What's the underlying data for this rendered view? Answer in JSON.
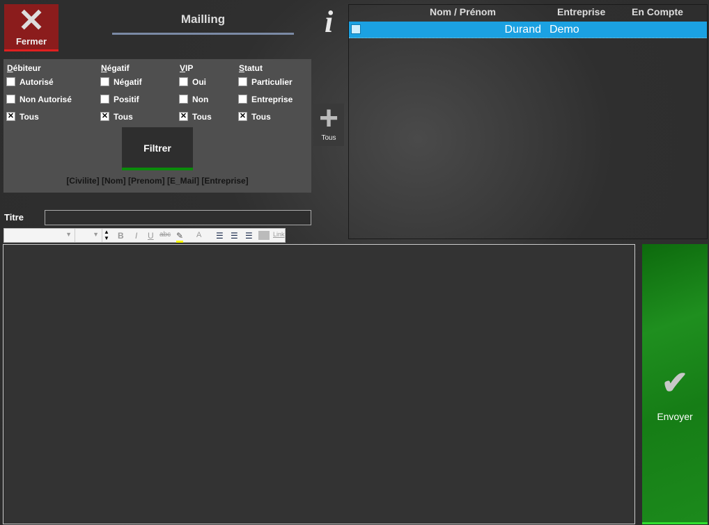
{
  "header": {
    "close_label": "Fermer",
    "title": "Mailling"
  },
  "filters": {
    "columns": [
      {
        "title_first": "D",
        "title_rest": "ébiteur",
        "options": [
          {
            "label": "Autorisé",
            "checked": false
          },
          {
            "label": "Non Autorisé",
            "checked": false
          },
          {
            "label": "Tous",
            "checked": true
          }
        ]
      },
      {
        "title_first": "N",
        "title_rest": "égatif",
        "options": [
          {
            "label": "Négatif",
            "checked": false
          },
          {
            "label": "Positif",
            "checked": false
          },
          {
            "label": "Tous",
            "checked": true
          }
        ]
      },
      {
        "title_first": "V",
        "title_rest": "IP",
        "options": [
          {
            "label": "Oui",
            "checked": false
          },
          {
            "label": "Non",
            "checked": false
          },
          {
            "label": "Tous",
            "checked": true
          }
        ]
      },
      {
        "title_first": "S",
        "title_rest": "tatut",
        "options": [
          {
            "label": "Particulier",
            "checked": false
          },
          {
            "label": "Entreprise",
            "checked": false
          },
          {
            "label": "Tous",
            "checked": true
          }
        ]
      }
    ],
    "filter_button": "Filtrer",
    "fields": "[Civilite] [Nom] [Prenom] [E_Mail] [Entreprise]"
  },
  "add_all": {
    "label": "Tous"
  },
  "grid": {
    "columns": [
      "Nom / Prénom",
      "Entreprise",
      "En Compte"
    ],
    "rows": [
      {
        "nom": "Durand",
        "entreprise": "Demo",
        "en_compte": "",
        "selected": true,
        "checked": false
      }
    ],
    "selected_color": "#1ba1e2"
  },
  "titre": {
    "label": "Titre",
    "value": ""
  },
  "toolbar": {
    "bold": "B",
    "italic": "I",
    "underline": "U",
    "strike": "abc",
    "font_color": "A",
    "link": "Link"
  },
  "send": {
    "label": "Envoyer"
  }
}
